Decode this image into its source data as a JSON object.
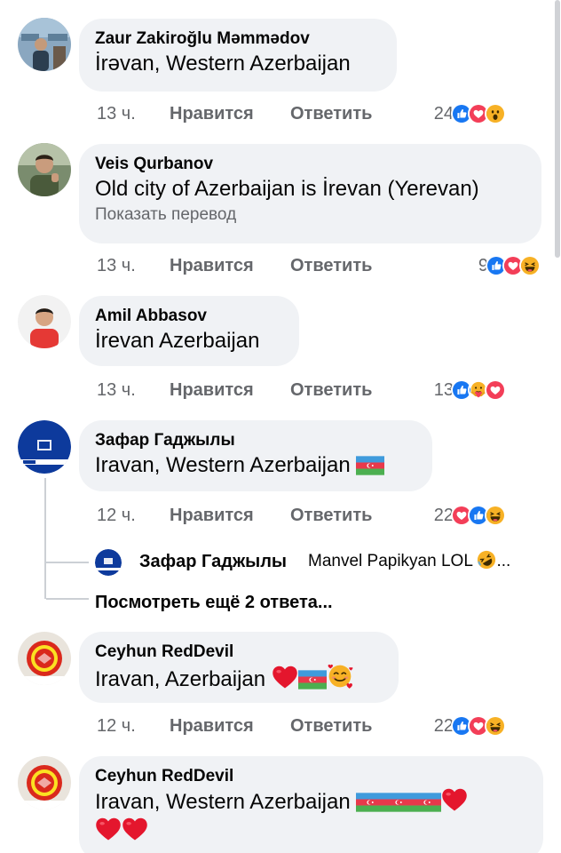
{
  "comments": [
    {
      "author": "Zaur Zakiroğlu Məmmədov",
      "text": "İrəvan, Western Azerbaijan",
      "time": "13 ч.",
      "like_label": "Нравится",
      "reply_label": "Ответить",
      "reaction_count": "24",
      "reactions": [
        "like",
        "love",
        "wow"
      ]
    },
    {
      "author": "Veis Qurbanov",
      "text": "Old city of Azerbaijan is İrevan (Yerevan)",
      "translate_label": "Показать перевод",
      "time": "13 ч.",
      "like_label": "Нравится",
      "reply_label": "Ответить",
      "reaction_count": "9",
      "reactions": [
        "like",
        "love",
        "haha"
      ]
    },
    {
      "author": "Amil Abbasov",
      "text": "İrevan Azerbaijan",
      "time": "13 ч.",
      "like_label": "Нравится",
      "reply_label": "Ответить",
      "reaction_count": "13",
      "reactions": [
        "like",
        "care",
        "love"
      ]
    },
    {
      "author": "Зафар Гаджылы",
      "text": "Iravan, Western Azerbaijan",
      "time": "12 ч.",
      "like_label": "Нравится",
      "reply_label": "Ответить",
      "reaction_count": "22",
      "reactions": [
        "love",
        "like",
        "haha"
      ],
      "emojis": [
        "flag-az"
      ]
    },
    {
      "author": "Ceyhun RedDevil",
      "text": "Iravan, Azerbaijan",
      "time": "12 ч.",
      "like_label": "Нравится",
      "reply_label": "Ответить",
      "reaction_count": "22",
      "reactions": [
        "like",
        "love",
        "haha"
      ],
      "emojis": [
        "red-heart",
        "flag-az",
        "smiling-face-with-hearts"
      ]
    },
    {
      "author": "Ceyhun RedDevil",
      "text": "Iravan, Western Azerbaijan",
      "emojis": [
        "flag-az",
        "flag-az",
        "flag-az",
        "red-heart",
        "red-heart",
        "red-heart"
      ]
    }
  ],
  "nested_reply": {
    "author": "Зафар Гаджылы",
    "text": "Manvel Papikyan LOL",
    "ellipsis": "...",
    "emoji": "rolling-on-floor-laughing"
  },
  "more_replies_label": "Посмотреть ещё 2 ответа...",
  "colors": {
    "bubble": "#f0f2f5",
    "meta_text": "#65676b",
    "like_blue": "#1877f2",
    "love_red": "#f33e58",
    "emoji_yellow": "#f7b125"
  }
}
